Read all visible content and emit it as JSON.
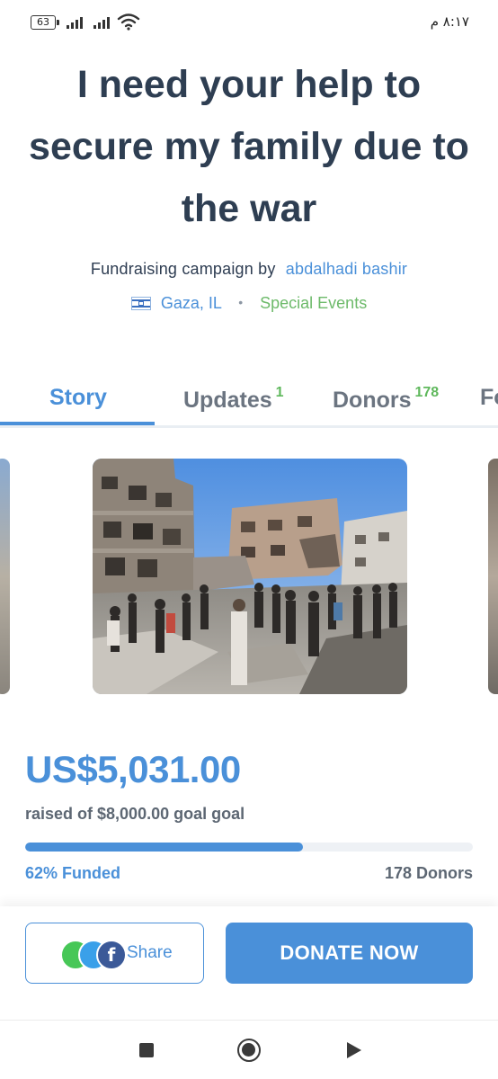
{
  "status_bar": {
    "battery": "63",
    "time": "٨:١٧ م"
  },
  "campaign": {
    "title": "I need your help to secure my family due to the war",
    "byline_prefix": "Fundraising campaign by",
    "author": "abdalhadi bashir",
    "location": "Gaza, IL",
    "separator": "•",
    "category": "Special Events"
  },
  "tabs": [
    {
      "label": "Story",
      "count": "",
      "active": true
    },
    {
      "label": "Updates",
      "count": "1",
      "active": false
    },
    {
      "label": "Donors",
      "count": "178",
      "active": false
    },
    {
      "label": "Fo",
      "count": "",
      "active": false
    }
  ],
  "funding": {
    "raised": "US$5,031.00",
    "goal_text": "raised of $8,000.00 goal goal",
    "funded_text": "62% Funded",
    "funded_fraction": 0.62,
    "donors_text": "178 Donors"
  },
  "actions": {
    "share_label": "Share",
    "donate_label": "DONATE NOW"
  },
  "colors": {
    "accent": "#4a90d9",
    "category_green": "#6dba6a",
    "title_navy": "#2e3e52"
  },
  "icons": [
    "whatsapp-icon",
    "twitter-icon",
    "facebook-icon",
    "israel-flag-icon",
    "wifi-icon",
    "battery-icon"
  ]
}
